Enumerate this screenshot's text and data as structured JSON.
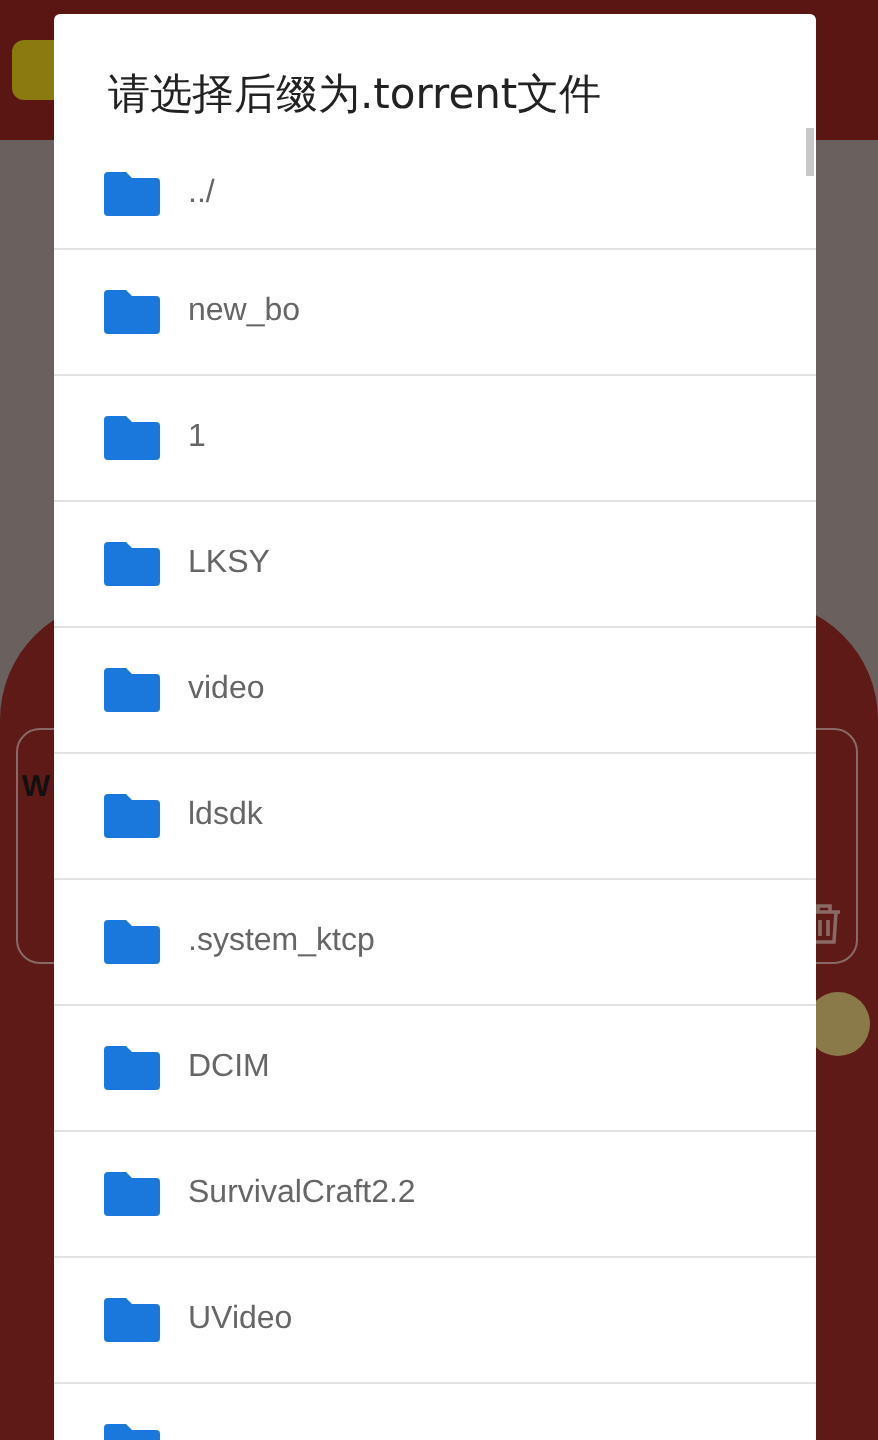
{
  "background_app": {
    "field_text": "W"
  },
  "dialog": {
    "title": "请选择后缀为.torrent文件",
    "folders": [
      {
        "name": "../"
      },
      {
        "name": "new_bo"
      },
      {
        "name": "1"
      },
      {
        "name": "LKSY"
      },
      {
        "name": "video"
      },
      {
        "name": "ldsdk"
      },
      {
        "name": ".system_ktcp"
      },
      {
        "name": "DCIM"
      },
      {
        "name": "SurvivalCraft2.2"
      },
      {
        "name": "UVideo"
      }
    ],
    "more_below": true
  }
}
